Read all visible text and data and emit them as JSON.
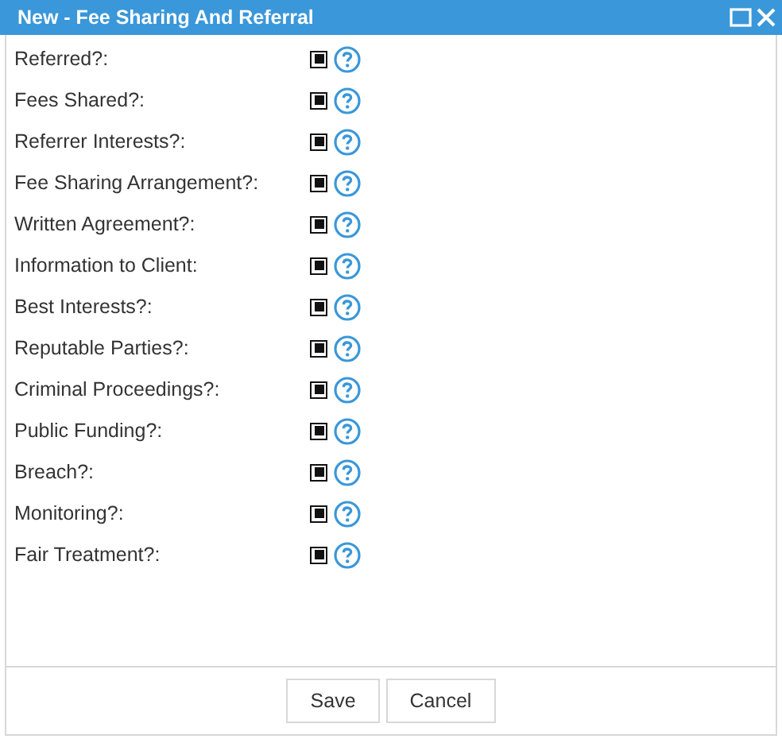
{
  "window": {
    "title": "New - Fee Sharing And Referral"
  },
  "fields": [
    {
      "label": "Referred?:",
      "checked": true
    },
    {
      "label": "Fees Shared?:",
      "checked": true
    },
    {
      "label": "Referrer Interests?:",
      "checked": true
    },
    {
      "label": "Fee Sharing Arrangement?:",
      "checked": true
    },
    {
      "label": "Written Agreement?:",
      "checked": true
    },
    {
      "label": "Information to Client:",
      "checked": true
    },
    {
      "label": "Best Interests?:",
      "checked": true
    },
    {
      "label": "Reputable Parties?:",
      "checked": true
    },
    {
      "label": "Criminal Proceedings?:",
      "checked": true
    },
    {
      "label": "Public Funding?:",
      "checked": true
    },
    {
      "label": "Breach?:",
      "checked": true
    },
    {
      "label": "Monitoring?:",
      "checked": true
    },
    {
      "label": "Fair Treatment?:",
      "checked": true
    }
  ],
  "buttons": [
    "Save",
    "Cancel"
  ]
}
